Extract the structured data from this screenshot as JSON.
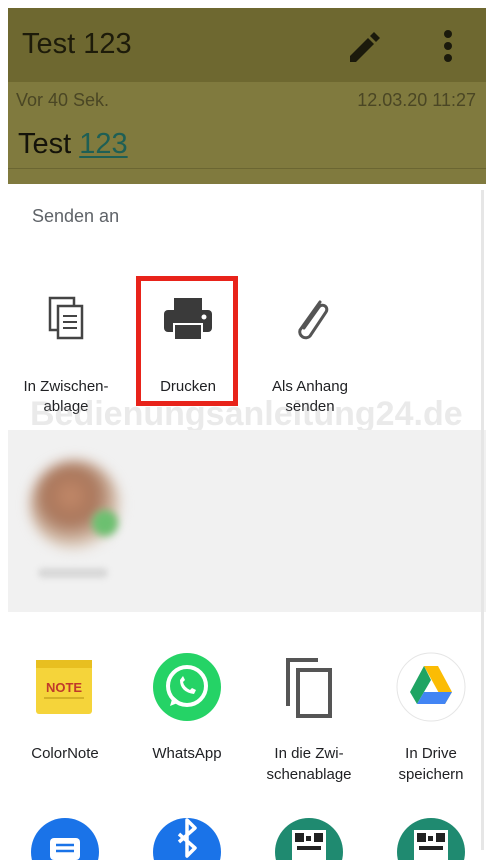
{
  "note": {
    "title": "Test 123",
    "meta_left": "Vor 40 Sek.",
    "meta_right": "12.03.20 11:27",
    "body_plain": "Test ",
    "body_link": "123"
  },
  "share_sheet": {
    "header": "Senden an",
    "targets": [
      {
        "label": "In Zwischen-\nablage",
        "icon": "copy-document-icon"
      },
      {
        "label": "Drucken",
        "icon": "printer-icon"
      },
      {
        "label": "Als Anhang\nsenden",
        "icon": "paperclip-icon"
      }
    ],
    "apps": [
      {
        "label": "ColorNote",
        "icon": "colornote-icon"
      },
      {
        "label": "WhatsApp",
        "icon": "whatsapp-icon"
      },
      {
        "label": "In die Zwi-\nschenablage",
        "icon": "copy-icon"
      },
      {
        "label": "In Drive\nspeichern",
        "icon": "google-drive-icon"
      }
    ],
    "bottom_row_icons": [
      "messages-icon",
      "bluetooth-icon",
      "qr-code-icon",
      "qr-code-icon"
    ]
  },
  "watermark": "Bedienungsanleitung24.de",
  "colors": {
    "highlight": "#e8231a",
    "whatsapp": "#25d366",
    "note_yellow": "#f5d43a"
  }
}
